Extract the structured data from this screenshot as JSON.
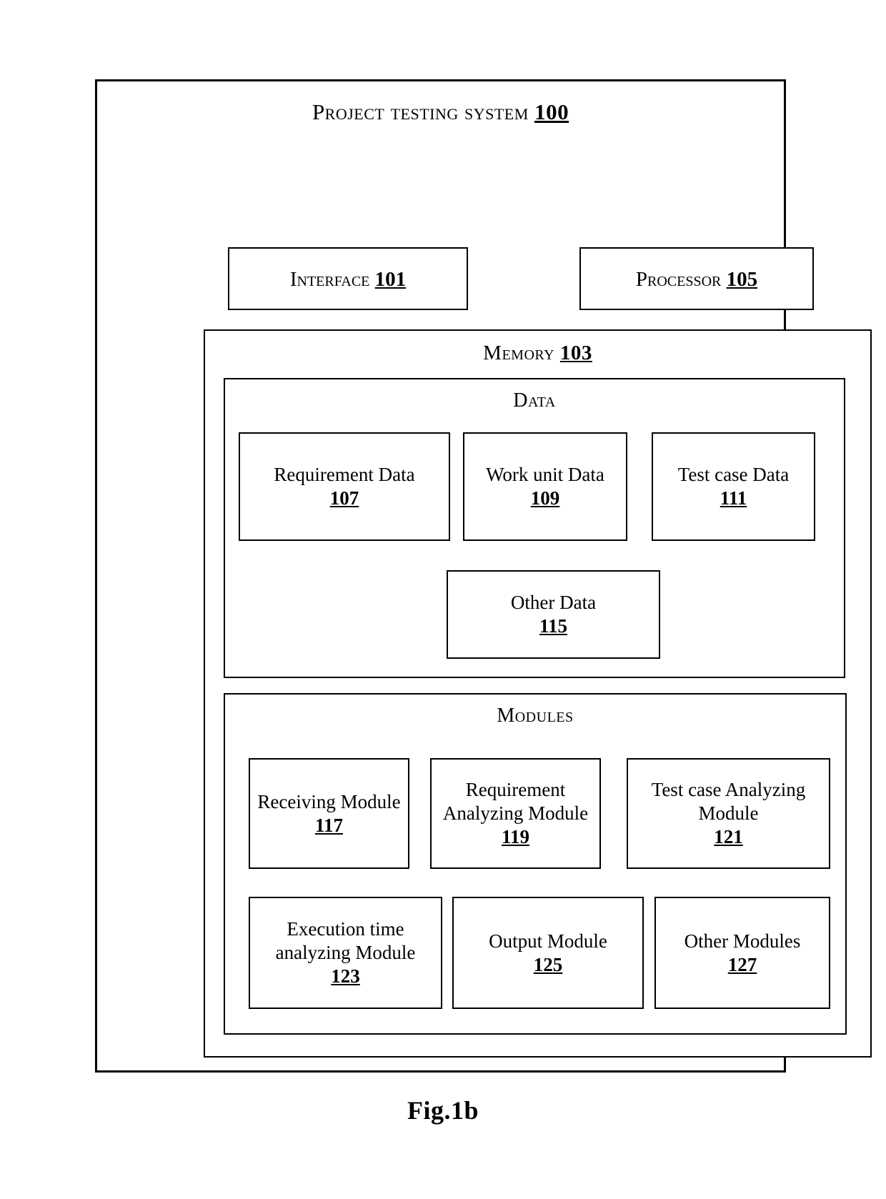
{
  "figure": {
    "caption": "Fig.1b"
  },
  "system": {
    "title_text": "Project testing system",
    "title_ref": "100",
    "interface": {
      "label": "Interface",
      "ref": "101"
    },
    "processor": {
      "label": "Processor",
      "ref": "105"
    },
    "memory": {
      "label": "Memory",
      "ref": "103",
      "data_section": {
        "label": "Data",
        "items": [
          {
            "label": "Requirement Data",
            "ref": "107"
          },
          {
            "label": "Work unit Data",
            "ref": "109"
          },
          {
            "label": "Test case Data",
            "ref": "111"
          },
          {
            "label": "Other Data",
            "ref": "115"
          }
        ]
      },
      "modules_section": {
        "label": "Modules",
        "items": [
          {
            "label": "Receiving Module",
            "ref": "117"
          },
          {
            "label": "Requirement Analyzing Module",
            "ref": "119"
          },
          {
            "label": "Test case Analyzing Module",
            "ref": "121"
          },
          {
            "label": "Execution time analyzing Module",
            "ref": "123"
          },
          {
            "label": "Output Module",
            "ref": "125"
          },
          {
            "label": "Other Modules",
            "ref": "127"
          }
        ]
      }
    }
  },
  "colors": {
    "stroke": "#000000",
    "background": "#ffffff"
  }
}
